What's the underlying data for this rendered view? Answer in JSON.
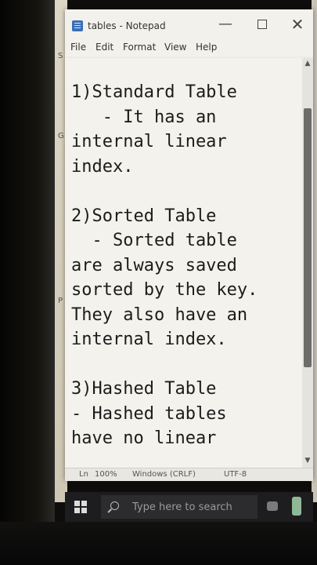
{
  "window": {
    "title": "tables - Notepad",
    "controls": {
      "minimize": "—",
      "maximize": "",
      "close": "✕"
    }
  },
  "menu": {
    "file": "File",
    "edit": "Edit",
    "format": "Format",
    "view": "View",
    "help": "Help"
  },
  "editor": {
    "content": "1)Standard Table\n   - It has an\ninternal linear\nindex.\n\n2)Sorted Table\n  - Sorted table\nare always saved\nsorted by the key.\nThey also have an\ninternal index.\n\n3)Hashed Table\n- Hashed tables\nhave no linear"
  },
  "status": {
    "position": "Ln",
    "zoom": "100%",
    "line_ending": "Windows (CRLF)",
    "encoding": "UTF-8"
  },
  "taskbar": {
    "search_placeholder": "Type here to search"
  },
  "desktop_edge": {
    "s": "S",
    "g": "G",
    "p": "P"
  },
  "icons": [
    "notepad-icon",
    "windows-start-icon",
    "search-icon",
    "camera-icon"
  ],
  "colors": {
    "editor_bg": "#f3f2ec",
    "taskbar_bg": "#1d1d1f",
    "scroll_thumb": "#6d6c68"
  }
}
